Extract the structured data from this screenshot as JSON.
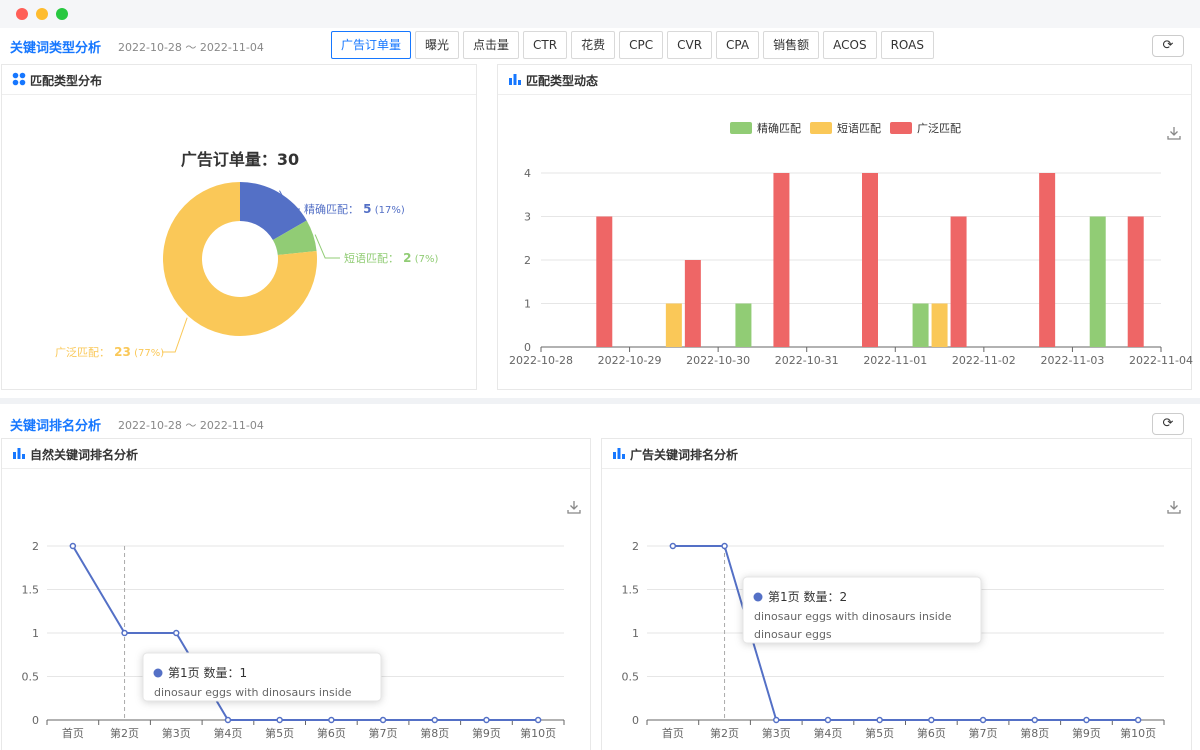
{
  "window": {
    "dots": [
      "red",
      "yellow",
      "green"
    ]
  },
  "section1": {
    "title": "关键词类型分析",
    "date_range": "2022-10-28 ～ 2022-11-04",
    "tabs": [
      {
        "label": "广告订单量",
        "active": true
      },
      {
        "label": "曝光"
      },
      {
        "label": "点击量"
      },
      {
        "label": "CTR"
      },
      {
        "label": "花费"
      },
      {
        "label": "CPC"
      },
      {
        "label": "CVR"
      },
      {
        "label": "CPA"
      },
      {
        "label": "销售额"
      },
      {
        "label": "ACOS"
      },
      {
        "label": "ROAS"
      }
    ],
    "refresh_icon": "refresh-icon",
    "pie_panel": {
      "title": "匹配类型分布",
      "icon": "grid-icon",
      "heading": "广告订单量：30"
    },
    "bar_panel": {
      "title": "匹配类型动态",
      "icon": "bar-chart-icon",
      "download_icon": "download-icon"
    }
  },
  "section2": {
    "title": "关键词排名分析",
    "date_range": "2022-10-28 ～ 2022-11-04",
    "refresh_icon": "refresh-icon",
    "organic_panel": {
      "title": "自然关键词排名分析",
      "icon": "bar-chart-icon",
      "download_icon": "download-icon",
      "tooltip": {
        "label": "第1页 数量：",
        "value": "1",
        "lines": [
          "dinosaur eggs with dinosaurs inside"
        ]
      }
    },
    "ad_panel": {
      "title": "广告关键词排名分析",
      "icon": "bar-chart-icon",
      "download_icon": "download-icon",
      "tooltip": {
        "label": "第1页 数量：",
        "value": "2",
        "lines": [
          "dinosaur eggs with dinosaurs inside",
          "dinosaur eggs"
        ]
      }
    }
  },
  "chart_data": [
    {
      "type": "pie",
      "title": "广告订单量：30",
      "colors": [
        "#5470c6",
        "#91cc75",
        "#fac858"
      ],
      "slices": [
        {
          "name": "精确匹配",
          "value": 5,
          "percent": "(17%)"
        },
        {
          "name": "短语匹配",
          "value": 2,
          "percent": "(7%)"
        },
        {
          "name": "广泛匹配",
          "value": 23,
          "percent": "(77%)"
        }
      ]
    },
    {
      "type": "bar",
      "categories": [
        "2022-10-28",
        "2022-10-29",
        "2022-10-30",
        "2022-10-31",
        "2022-11-01",
        "2022-11-02",
        "2022-11-03",
        "2022-11-04"
      ],
      "ylim": [
        0,
        4
      ],
      "yticks": [
        "0",
        "1",
        "2",
        "3",
        "4"
      ],
      "legend_position": "top-center",
      "grid": true,
      "series": [
        {
          "name": "精确匹配",
          "color": "#91cc75",
          "values": [
            0,
            0,
            1,
            0,
            1,
            0,
            3
          ]
        },
        {
          "name": "短语匹配",
          "color": "#fac858",
          "values": [
            0,
            1,
            0,
            0,
            1,
            0,
            0
          ]
        },
        {
          "name": "广泛匹配",
          "color": "#ee6666",
          "values": [
            3,
            2,
            4,
            4,
            3,
            4,
            3
          ]
        }
      ]
    },
    {
      "type": "line",
      "categories": [
        "首页",
        "第2页",
        "第3页",
        "第4页",
        "第5页",
        "第6页",
        "第7页",
        "第8页",
        "第9页",
        "第10页"
      ],
      "ylim": [
        0,
        2
      ],
      "yticks": [
        "0",
        "0.5",
        "1",
        "1.5",
        "2"
      ],
      "grid": true,
      "color": "#5470c6",
      "values": [
        2,
        1,
        1,
        0,
        0,
        0,
        0,
        0,
        0,
        0
      ],
      "highlight_index": 1
    },
    {
      "type": "line",
      "categories": [
        "首页",
        "第2页",
        "第3页",
        "第4页",
        "第5页",
        "第6页",
        "第7页",
        "第8页",
        "第9页",
        "第10页"
      ],
      "ylim": [
        0,
        2
      ],
      "yticks": [
        "0",
        "0.5",
        "1",
        "1.5",
        "2"
      ],
      "grid": true,
      "color": "#5470c6",
      "values": [
        2,
        2,
        0,
        0,
        0,
        0,
        0,
        0,
        0,
        0
      ],
      "highlight_index": 1
    }
  ]
}
